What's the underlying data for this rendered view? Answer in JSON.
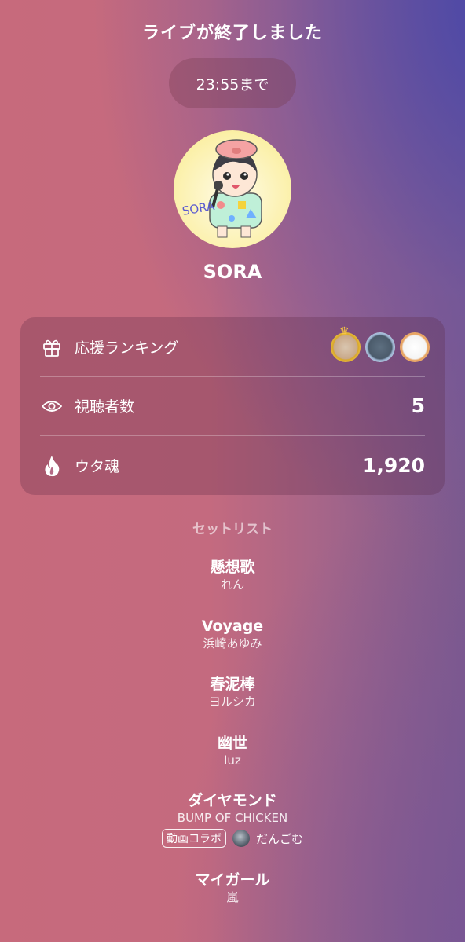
{
  "header": {
    "title": "ライブが終了しました",
    "countdown": "23:55まで"
  },
  "profile": {
    "username": "SORA",
    "avatar_signature": "SORA"
  },
  "stats": {
    "ranking_label": "応援ランキング",
    "viewers_label": "視聴者数",
    "viewers_value": "5",
    "uta_label": "ウタ魂",
    "uta_value": "1,920",
    "icons": [
      "gift-icon",
      "eye-icon",
      "flame-icon"
    ]
  },
  "setlist": {
    "title": "セットリスト",
    "songs": [
      {
        "title": "懸想歌",
        "artist": "れん"
      },
      {
        "title": "Voyage",
        "artist": "浜崎あゆみ"
      },
      {
        "title": "春泥棒",
        "artist": "ヨルシカ"
      },
      {
        "title": "幽世",
        "artist": "luz"
      },
      {
        "title": "ダイヤモンド",
        "artist": "BUMP OF CHICKEN",
        "collab_tag": "動画コラボ",
        "collab_user": "だんごむ"
      },
      {
        "title": "マイガール",
        "artist": "嵐"
      }
    ]
  }
}
